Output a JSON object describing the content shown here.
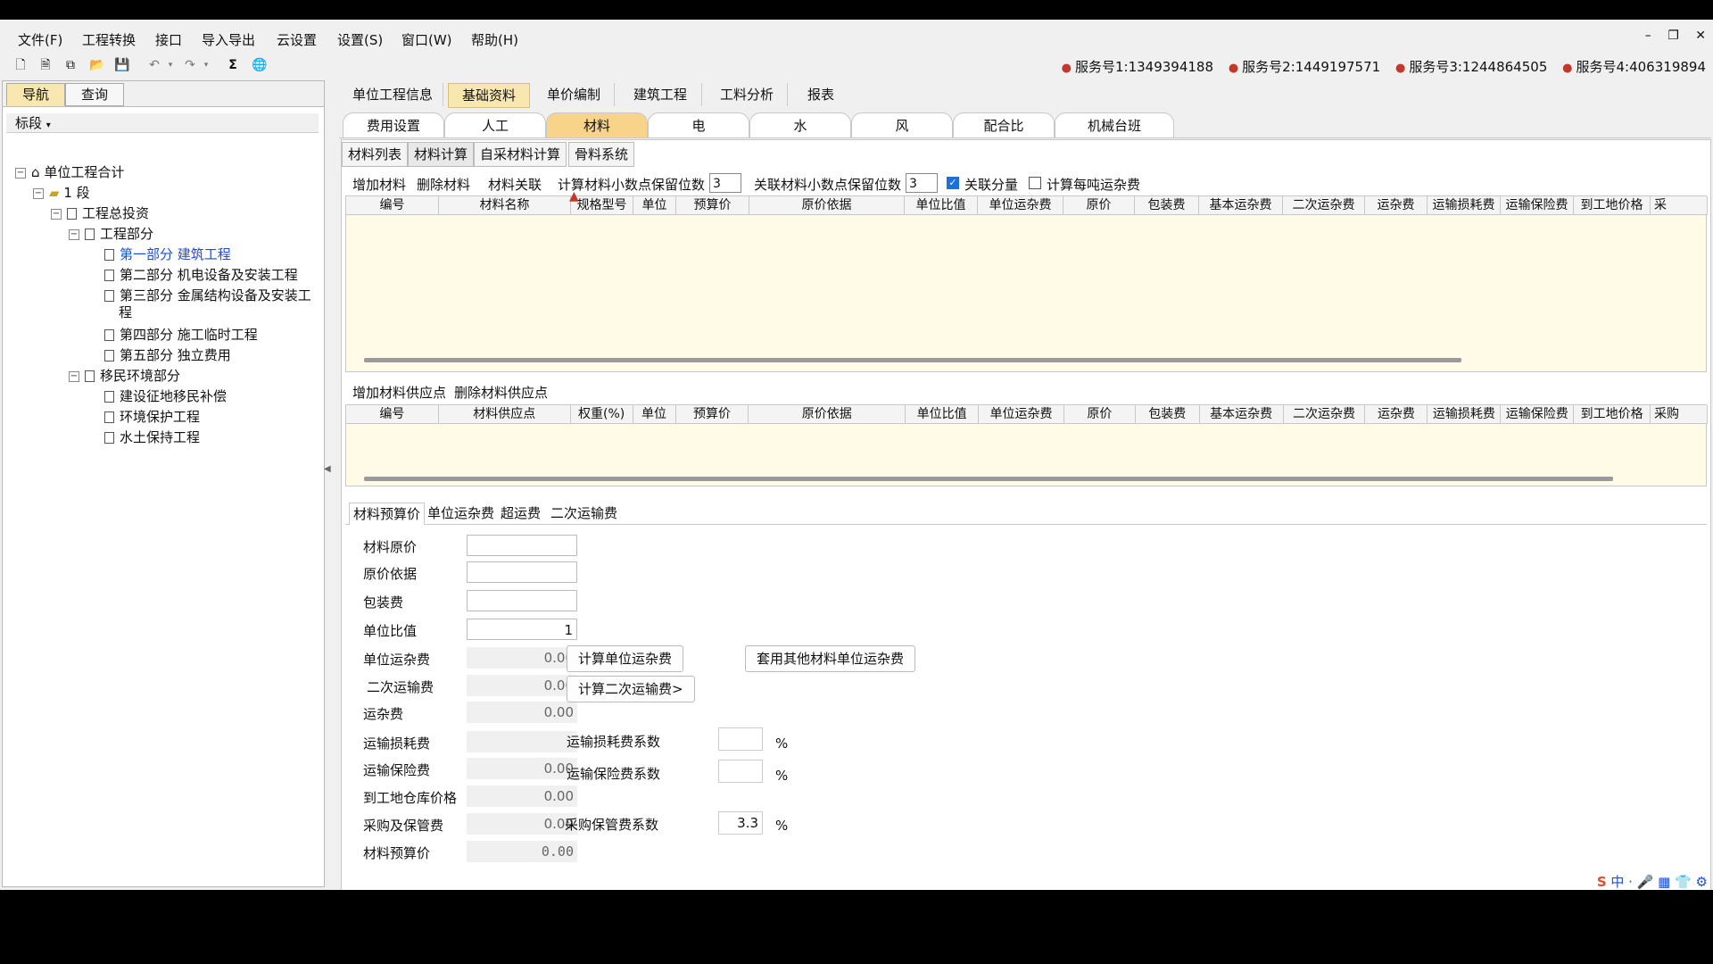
{
  "menu": [
    "文件(F)",
    "工程转换",
    "接口",
    "导入导出",
    "云设置",
    "设置(S)",
    "窗口(W)",
    "帮助(H)"
  ],
  "window_controls": [
    "–",
    "❐",
    "✕"
  ],
  "services": [
    "服务号1:1349394188",
    "服务号2:1449197571",
    "服务号3:1244864505",
    "服务号4:406319894"
  ],
  "left": {
    "tabs": [
      "导航",
      "查询"
    ],
    "dropdown": "标段",
    "tree": [
      {
        "label": "单位工程合计",
        "level": 0
      },
      {
        "label": "1 段",
        "level": 1
      },
      {
        "label": "工程总投资",
        "level": 2
      },
      {
        "label": "工程部分",
        "level": 3
      },
      {
        "label": "第一部分 建筑工程",
        "level": 4
      },
      {
        "label": "第二部分 机电设备及安装工程",
        "level": 4
      },
      {
        "label": "第三部分 金属结构设备及安装工",
        "level": 4
      },
      {
        "label": "程",
        "level": 4
      },
      {
        "label": "第四部分 施工临时工程",
        "level": 4
      },
      {
        "label": "第五部分 独立费用",
        "level": 4
      },
      {
        "label": "移民环境部分",
        "level": 3
      },
      {
        "label": "建设征地移民补偿",
        "level": 4
      },
      {
        "label": "环境保护工程",
        "level": 4
      },
      {
        "label": "水土保持工程",
        "level": 4
      }
    ]
  },
  "main_tabs": [
    "单位工程信息",
    "基础资料",
    "单价编制",
    "建筑工程",
    "工料分析",
    "报表"
  ],
  "sub_tabs": [
    "费用设置",
    "人工",
    "材料",
    "电",
    "水",
    "风",
    "配合比",
    "机械台班"
  ],
  "inner_tabs": [
    "材料列表",
    "材料计算",
    "自采材料计算",
    "骨料系统"
  ],
  "material_actions": {
    "add": "增加材料",
    "delete": "删除材料",
    "link": "材料关联",
    "decimals_label": "计算材料小数点保留位数",
    "decimals_value": "3",
    "linked_decimals_label": "关联材料小数点保留位数",
    "linked_decimals_value": "3",
    "link_amount": "关联分量",
    "per_ton": "计算每吨运杂费"
  },
  "material_columns": [
    "编号",
    "材料名称",
    "规格型号",
    "单位",
    "预算价",
    "原价依据",
    "单位比值",
    "单位运杂费",
    "原价",
    "包装费",
    "基本运杂费",
    "二次运杂费",
    "运杂费",
    "运输损耗费",
    "运输保险费",
    "到工地价格",
    "采"
  ],
  "supply_actions": {
    "add": "增加材料供应点",
    "delete": "删除材料供应点"
  },
  "supply_columns": [
    "编号",
    "材料供应点",
    "权重(%)",
    "单位",
    "预算价",
    "原价依据",
    "单位比值",
    "单位运杂费",
    "原价",
    "包装费",
    "基本运杂费",
    "二次运杂费",
    "运杂费",
    "运输损耗费",
    "运输保险费",
    "到工地价格",
    "采购"
  ],
  "bottom_tabs": [
    "材料预算价",
    "单位运杂费",
    "超运费",
    "二次运输费"
  ],
  "form": {
    "labels": [
      "材料原价",
      "原价依据",
      "包装费",
      "单位比值",
      "单位运杂费",
      "二次运输费",
      "运杂费",
      "运输损耗费",
      "运输保险费",
      "到工地仓库价格",
      "采购及保管费",
      "材料预算价"
    ],
    "values": [
      "",
      "",
      "",
      "1",
      "0.00",
      "0.00",
      "0.00",
      "",
      "0.00",
      "0.00",
      "0.00",
      "0.00"
    ],
    "btn_calc_unit": "计算单位运杂费",
    "btn_apply_other": "套用其他材料单位运杂费",
    "btn_calc_second": "计算二次运输费>",
    "loss_coef_label": "运输损耗费系数",
    "loss_coef_value": "",
    "insurance_coef_label": "运输保险费系数",
    "insurance_coef_value": "",
    "storage_coef_label": "采购保管费系数",
    "storage_coef_value": "3.3",
    "percent": "%"
  },
  "tray": "中 · 🎤 ▦ 👕 ⚙"
}
